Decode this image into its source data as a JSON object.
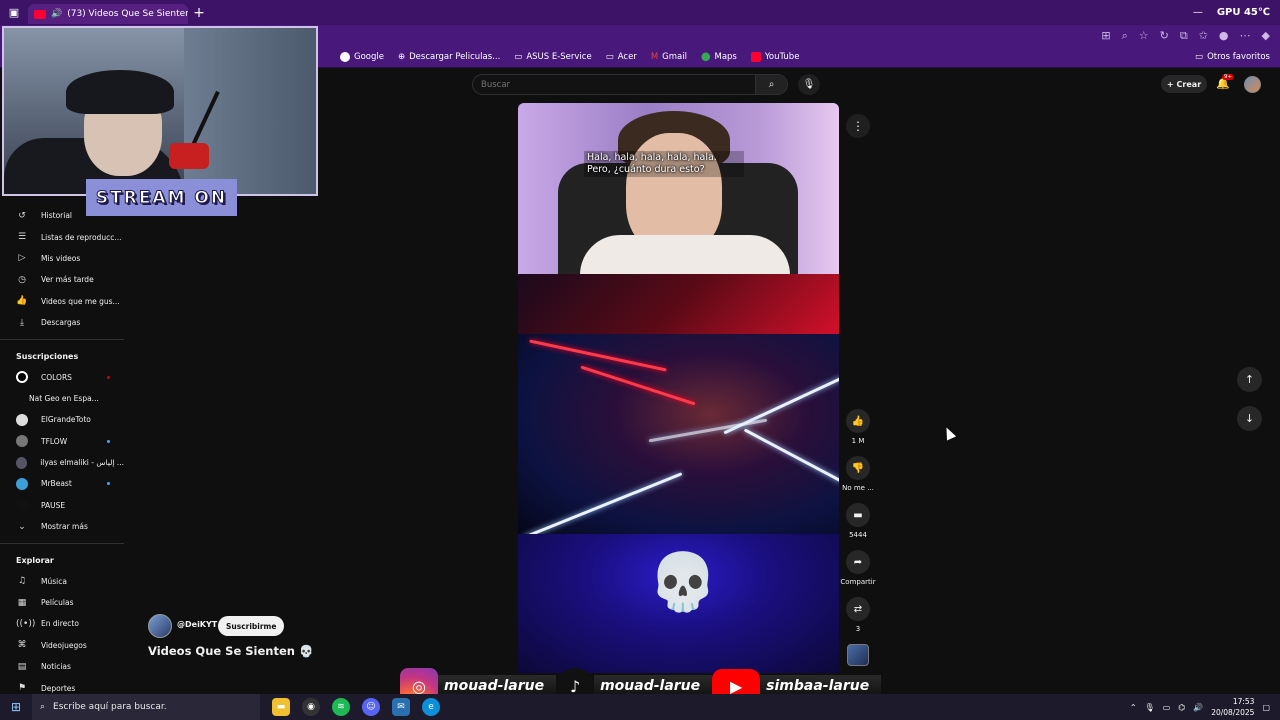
{
  "browser": {
    "tab_title": "(73) Videos Que Se Sienten 💀",
    "gpu": "GPU 45℃",
    "bookmarks": [
      "Google",
      "Descargar Peliculas...",
      "ASUS E-Service",
      "Acer",
      "Gmail",
      "Maps",
      "YouTube"
    ],
    "other_favorites": "Otros favoritos"
  },
  "colors": {
    "chrome_purple": "#48187a",
    "accent_red": "#ff0033",
    "bg": "#0f0f0f"
  },
  "youtube": {
    "search_placeholder": "Buscar",
    "create_label": "Crear",
    "notif_badge": "9+"
  },
  "stream_overlay": {
    "label": "STREAM ON"
  },
  "sidebar": {
    "you_items": [
      {
        "label": "Historial",
        "icon": "history-icon"
      },
      {
        "label": "Listas de reproducc...",
        "icon": "playlist-icon"
      },
      {
        "label": "Mis videos",
        "icon": "my-videos-icon"
      },
      {
        "label": "Ver más tarde",
        "icon": "watch-later-icon"
      },
      {
        "label": "Videos que me gus...",
        "icon": "like-icon"
      },
      {
        "label": "Descargas",
        "icon": "download-icon"
      }
    ],
    "subs_title": "Suscripciones",
    "subs": [
      {
        "label": "COLORS"
      },
      {
        "label": "Nat Geo en Espa..."
      },
      {
        "label": "ElGrandeToto"
      },
      {
        "label": "TFLOW"
      },
      {
        "label": "ilyas elmaliki - إلياس ..."
      },
      {
        "label": "MrBeast"
      },
      {
        "label": "PAUSE"
      }
    ],
    "show_more": "Mostrar más",
    "explore_title": "Explorar",
    "explore": [
      {
        "label": "Música"
      },
      {
        "label": "Películas"
      },
      {
        "label": "En directo"
      },
      {
        "label": "Videojuegos"
      },
      {
        "label": "Noticias"
      },
      {
        "label": "Deportes"
      }
    ]
  },
  "short": {
    "caption": "Hala, hala, hala, hala, hala. Pero, ¿cuánto dura esto?",
    "channel": "@DeiKYT",
    "subscribe": "Suscribirme",
    "title": "Videos Que Se Sienten 💀",
    "likes": "1 M",
    "dislike": "No me ...",
    "comments": "5444",
    "share": "Compartir",
    "remix": "3"
  },
  "social": {
    "instagram": "mouad-larue",
    "tiktok": "mouad-larue",
    "youtube": "simbaa-larue"
  },
  "taskbar": {
    "search": "Escribe aquí para buscar.",
    "time": "17:53",
    "date": "20/08/2025"
  }
}
